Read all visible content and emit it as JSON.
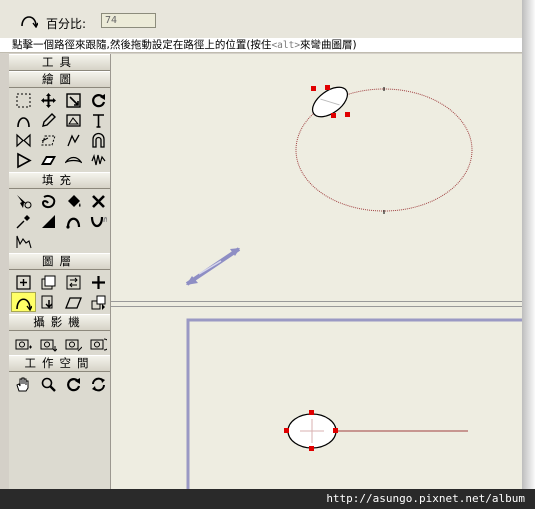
{
  "topbar": {
    "percent_label": "百分比:",
    "percent_value": "74"
  },
  "hint": {
    "text_before": "點擊一個路徑來跟隨,然後拖動設定在路徑上的位置(按住",
    "alt_key": "<alt>",
    "text_after": "來彎曲圖層)"
  },
  "toolbox": {
    "title": "工具",
    "sections": [
      {
        "label": "繪圖",
        "tools": [
          "select-rect",
          "move",
          "scale",
          "rotate",
          "bezier",
          "pencil",
          "shape-edit",
          "text",
          "mirror",
          "skew",
          "warp",
          "envelope",
          "polygon",
          "parallelogram",
          "bend",
          "jitter"
        ]
      },
      {
        "label": "填充",
        "tools": [
          "lasso-fill",
          "blob",
          "paint-bucket",
          "delete-fill",
          "eyedropper",
          "gradient",
          "tweak-curve",
          "tweak-curve-2",
          "smooth"
        ]
      },
      {
        "label": "圖層",
        "tools": [
          "layer-add",
          "layer-duplicate",
          "layer-switch",
          "layer-move",
          "follow-path",
          "layer-down",
          "layer-shear",
          "layer-group"
        ]
      },
      {
        "label": "攝影機",
        "tools": [
          "camera-add",
          "camera-move",
          "camera-zoom",
          "camera-rotate"
        ]
      },
      {
        "label": "工作空間",
        "tools": [
          "hand",
          "zoom",
          "rotate-view",
          "refresh"
        ]
      }
    ],
    "active_tool": "follow-path"
  },
  "footer": {
    "url": "http://asungo.pixnet.net/album"
  },
  "colors": {
    "accent": "#9a99c4",
    "handle": "#e00000",
    "path": "#a04040",
    "active_tool": "#ffff66"
  }
}
